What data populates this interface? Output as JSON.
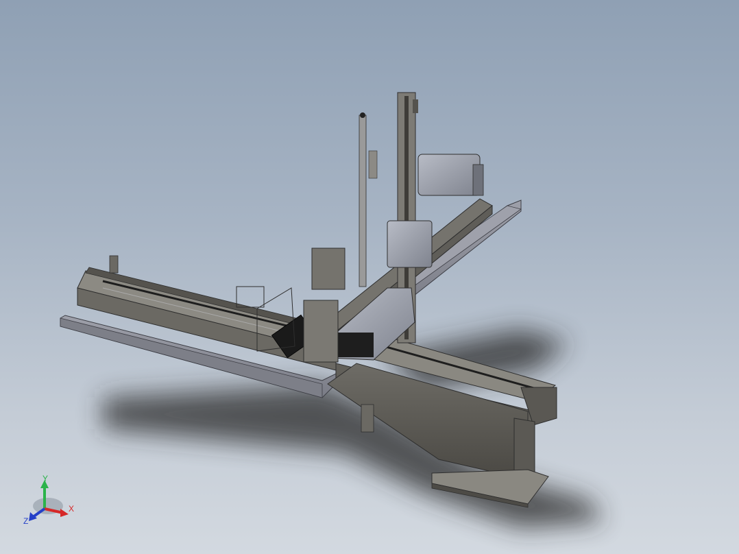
{
  "viewport": {
    "background_top": "#8fa0b4",
    "background_bottom": "#d3d9e0"
  },
  "triad": {
    "x_label": "X",
    "y_label": "Y",
    "z_label": "Z",
    "x_color": "#d62828",
    "y_color": "#2bb34a",
    "z_color": "#2540c8"
  },
  "icons": [
    "coordinate-triad-icon"
  ]
}
